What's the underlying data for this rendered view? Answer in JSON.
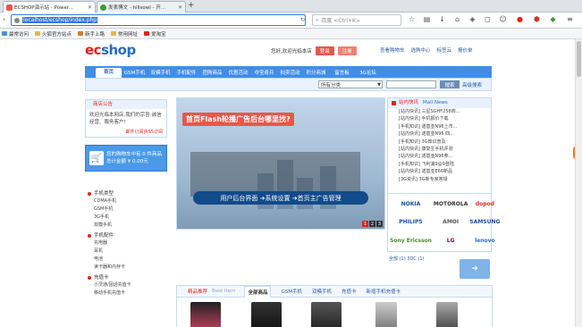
{
  "browser": {
    "tabs": [
      {
        "title": "ECSHOP演示站 - Power...",
        "active": true
      },
      {
        "title": "发表博文 - hillsowl - 开...",
        "active": false
      }
    ],
    "url": "localhost/ecshop/index.php",
    "search_placeholder": "百度 <Ctrl+K>",
    "bookmarks": [
      "最常访问",
      "火狐官方站点",
      "新手上路",
      "常用网址",
      "爱淘宝"
    ]
  },
  "site": {
    "logo_prefix": "ec",
    "logo_rest": "shop",
    "welcome": "您好,欢迎光临本店",
    "login": "登录",
    "register": "注册",
    "toplinks": [
      "查看购物车",
      "选购中心",
      "标签云",
      "报价单"
    ],
    "nav": [
      "首页",
      "GSM手机",
      "双模手机",
      "手机配件",
      "团购商品",
      "优惠活动",
      "夺宝奇兵",
      "拍卖活动",
      "积分商城",
      "留言板",
      "3G论坛"
    ],
    "search": {
      "category": "所有分类",
      "button": "搜索",
      "advanced": "高级搜索"
    }
  },
  "notice": {
    "title": "商店公告",
    "body": "欢迎光临本网店,我们的宗旨:诚信经营、服务客户!",
    "link": "邮件订阅|RSS订阅"
  },
  "promo": {
    "line1": "您的购物车中有 0 件商品",
    "line2": "总计金额 ¥ 0.00元"
  },
  "categories": [
    {
      "title": "手机类型",
      "items": [
        "CDMA手机",
        "GSM手机",
        "3G手机",
        "双模手机"
      ]
    },
    {
      "title": "手机配件",
      "items": [
        "充电器",
        "耳机",
        "电池",
        "读卡器和内存卡"
      ]
    },
    {
      "title": "充值卡",
      "items": [
        "小灵通/固话充值卡",
        "移动手机充值卡"
      ]
    }
  ],
  "flash": {
    "headline": "首页Flash轮播广告后台哪里找?",
    "cta": "用户后台界面 ➔系统设置 ➔首页主广告管理",
    "pages": [
      "1",
      "2",
      "3"
    ]
  },
  "news": {
    "title": "站内快讯",
    "title_en": "Mall News",
    "items": [
      "[站内快讯] 三星SGHF258商...",
      "[站内快讯] 手机报价下载",
      "[手机知识] 诺基亚N96上市...",
      "[站内快讯] 诺基亚N95 四...",
      "[手机知识] 3G知识普及",
      "[站内快讯] 康复生手机评测",
      "[站内快讯] 诺基亚N96参...",
      "[手机知识] 飞利浦9@9登陆",
      "[站内快讯] 诺基亚E66新品",
      "[3G资讯] 3G新专家答疑"
    ]
  },
  "brands": [
    {
      "name": "NOKIA",
      "color": "#1b4fa0"
    },
    {
      "name": "MOTOROLA",
      "color": "#333333"
    },
    {
      "name": "dopod",
      "color": "#e0241b"
    },
    {
      "name": "PHILIPS",
      "color": "#1b4fa0"
    },
    {
      "name": "AMOI",
      "color": "#555555"
    },
    {
      "name": "SAMSUNG",
      "color": "#1b4fa0"
    },
    {
      "name": "Sony Ericsson",
      "color": "#4a8a2a"
    },
    {
      "name": "LG",
      "color": "#a5004f"
    },
    {
      "name": "lenovo",
      "color": "#2a6cc0"
    }
  ],
  "brand_pages": "全部 (1) 3DC (1)",
  "best": {
    "title": "精品推荐",
    "title_en": "Best Item",
    "tabs": [
      "全部商品",
      "GSM手机",
      "双模手机",
      "充值卡",
      "新增手机充值卡"
    ]
  }
}
